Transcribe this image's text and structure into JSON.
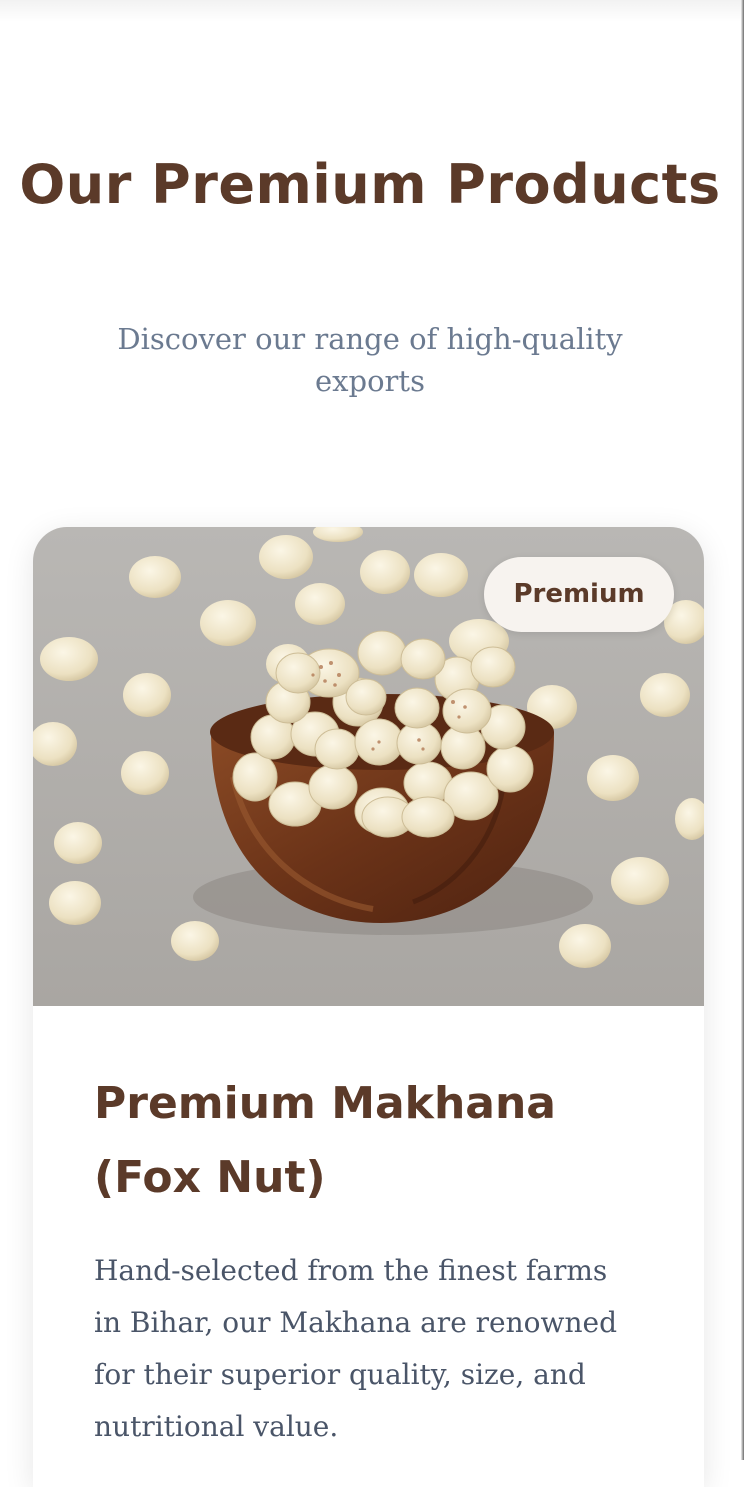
{
  "section": {
    "title": "Our Premium Products",
    "subtitle": "Discover our range of high-quality exports"
  },
  "product": {
    "badge": "Premium",
    "title": "Premium Makhana (Fox Nut)",
    "description": "Hand-selected from the finest farms in Bihar, our Makhana are renowned for their superior quality, size, and nutritional value.",
    "image_icon": "makhana-bowl-photo"
  },
  "colors": {
    "brand_brown": "#5b3a29",
    "subtitle_gray": "#6b7a90",
    "body_text": "#4a5568",
    "badge_bg": "#f7f3ef"
  }
}
